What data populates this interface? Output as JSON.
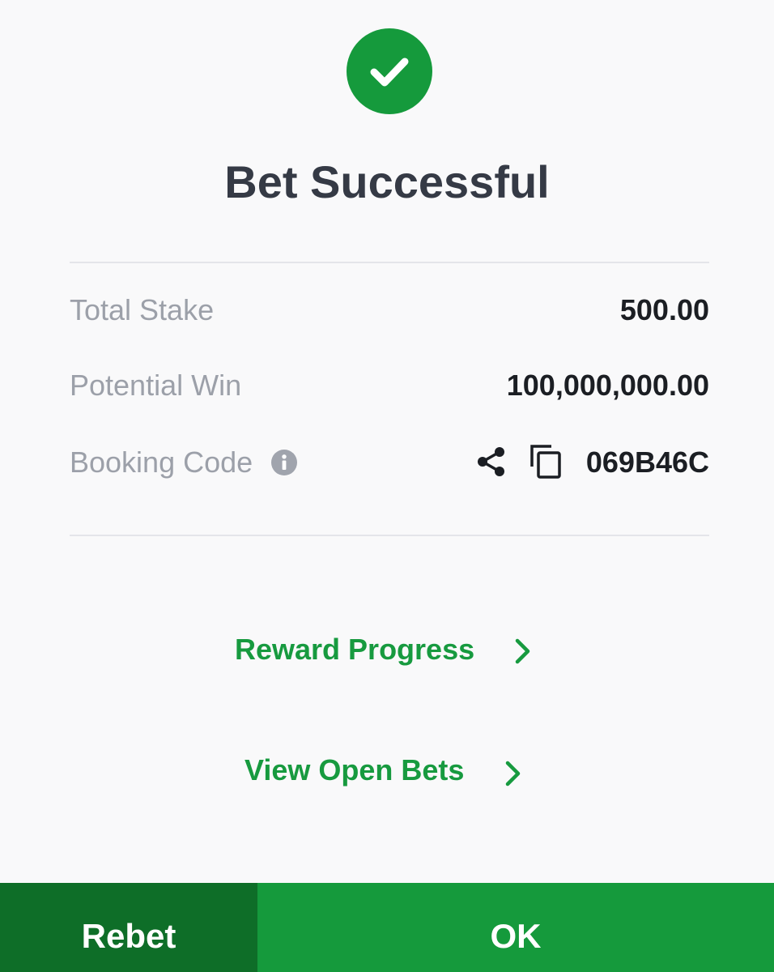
{
  "header": {
    "icon": "check-circle-icon",
    "title": "Bet Successful"
  },
  "summary": {
    "total_stake": {
      "label": "Total Stake",
      "value": "500.00"
    },
    "potential_win": {
      "label": "Potential Win",
      "value": "100,000,000.00"
    },
    "booking_code": {
      "label": "Booking Code",
      "info_icon": "info-icon",
      "share_icon": "share-icon",
      "copy_icon": "copy-icon",
      "value": "069B46C"
    }
  },
  "links": {
    "reward_progress": "Reward Progress",
    "view_open_bets": "View Open Bets"
  },
  "footer": {
    "rebet_label": "Rebet",
    "ok_label": "OK"
  },
  "colors": {
    "accent": "#159a3c",
    "accent_dark": "#0e6e28",
    "link": "#179a3f",
    "label": "#9ca0a9",
    "value": "#1b1e23",
    "title": "#353a45"
  }
}
